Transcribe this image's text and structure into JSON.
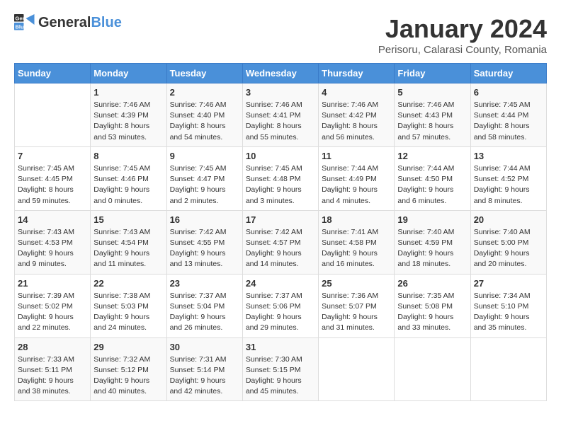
{
  "logo": {
    "general": "General",
    "blue": "Blue"
  },
  "title": "January 2024",
  "subtitle": "Perisoru, Calarasi County, Romania",
  "days_header": [
    "Sunday",
    "Monday",
    "Tuesday",
    "Wednesday",
    "Thursday",
    "Friday",
    "Saturday"
  ],
  "weeks": [
    [
      {
        "day": "",
        "info": ""
      },
      {
        "day": "1",
        "info": "Sunrise: 7:46 AM\nSunset: 4:39 PM\nDaylight: 8 hours\nand 53 minutes."
      },
      {
        "day": "2",
        "info": "Sunrise: 7:46 AM\nSunset: 4:40 PM\nDaylight: 8 hours\nand 54 minutes."
      },
      {
        "day": "3",
        "info": "Sunrise: 7:46 AM\nSunset: 4:41 PM\nDaylight: 8 hours\nand 55 minutes."
      },
      {
        "day": "4",
        "info": "Sunrise: 7:46 AM\nSunset: 4:42 PM\nDaylight: 8 hours\nand 56 minutes."
      },
      {
        "day": "5",
        "info": "Sunrise: 7:46 AM\nSunset: 4:43 PM\nDaylight: 8 hours\nand 57 minutes."
      },
      {
        "day": "6",
        "info": "Sunrise: 7:45 AM\nSunset: 4:44 PM\nDaylight: 8 hours\nand 58 minutes."
      }
    ],
    [
      {
        "day": "7",
        "info": "Sunrise: 7:45 AM\nSunset: 4:45 PM\nDaylight: 8 hours\nand 59 minutes."
      },
      {
        "day": "8",
        "info": "Sunrise: 7:45 AM\nSunset: 4:46 PM\nDaylight: 9 hours\nand 0 minutes."
      },
      {
        "day": "9",
        "info": "Sunrise: 7:45 AM\nSunset: 4:47 PM\nDaylight: 9 hours\nand 2 minutes."
      },
      {
        "day": "10",
        "info": "Sunrise: 7:45 AM\nSunset: 4:48 PM\nDaylight: 9 hours\nand 3 minutes."
      },
      {
        "day": "11",
        "info": "Sunrise: 7:44 AM\nSunset: 4:49 PM\nDaylight: 9 hours\nand 4 minutes."
      },
      {
        "day": "12",
        "info": "Sunrise: 7:44 AM\nSunset: 4:50 PM\nDaylight: 9 hours\nand 6 minutes."
      },
      {
        "day": "13",
        "info": "Sunrise: 7:44 AM\nSunset: 4:52 PM\nDaylight: 9 hours\nand 8 minutes."
      }
    ],
    [
      {
        "day": "14",
        "info": "Sunrise: 7:43 AM\nSunset: 4:53 PM\nDaylight: 9 hours\nand 9 minutes."
      },
      {
        "day": "15",
        "info": "Sunrise: 7:43 AM\nSunset: 4:54 PM\nDaylight: 9 hours\nand 11 minutes."
      },
      {
        "day": "16",
        "info": "Sunrise: 7:42 AM\nSunset: 4:55 PM\nDaylight: 9 hours\nand 13 minutes."
      },
      {
        "day": "17",
        "info": "Sunrise: 7:42 AM\nSunset: 4:57 PM\nDaylight: 9 hours\nand 14 minutes."
      },
      {
        "day": "18",
        "info": "Sunrise: 7:41 AM\nSunset: 4:58 PM\nDaylight: 9 hours\nand 16 minutes."
      },
      {
        "day": "19",
        "info": "Sunrise: 7:40 AM\nSunset: 4:59 PM\nDaylight: 9 hours\nand 18 minutes."
      },
      {
        "day": "20",
        "info": "Sunrise: 7:40 AM\nSunset: 5:00 PM\nDaylight: 9 hours\nand 20 minutes."
      }
    ],
    [
      {
        "day": "21",
        "info": "Sunrise: 7:39 AM\nSunset: 5:02 PM\nDaylight: 9 hours\nand 22 minutes."
      },
      {
        "day": "22",
        "info": "Sunrise: 7:38 AM\nSunset: 5:03 PM\nDaylight: 9 hours\nand 24 minutes."
      },
      {
        "day": "23",
        "info": "Sunrise: 7:37 AM\nSunset: 5:04 PM\nDaylight: 9 hours\nand 26 minutes."
      },
      {
        "day": "24",
        "info": "Sunrise: 7:37 AM\nSunset: 5:06 PM\nDaylight: 9 hours\nand 29 minutes."
      },
      {
        "day": "25",
        "info": "Sunrise: 7:36 AM\nSunset: 5:07 PM\nDaylight: 9 hours\nand 31 minutes."
      },
      {
        "day": "26",
        "info": "Sunrise: 7:35 AM\nSunset: 5:08 PM\nDaylight: 9 hours\nand 33 minutes."
      },
      {
        "day": "27",
        "info": "Sunrise: 7:34 AM\nSunset: 5:10 PM\nDaylight: 9 hours\nand 35 minutes."
      }
    ],
    [
      {
        "day": "28",
        "info": "Sunrise: 7:33 AM\nSunset: 5:11 PM\nDaylight: 9 hours\nand 38 minutes."
      },
      {
        "day": "29",
        "info": "Sunrise: 7:32 AM\nSunset: 5:12 PM\nDaylight: 9 hours\nand 40 minutes."
      },
      {
        "day": "30",
        "info": "Sunrise: 7:31 AM\nSunset: 5:14 PM\nDaylight: 9 hours\nand 42 minutes."
      },
      {
        "day": "31",
        "info": "Sunrise: 7:30 AM\nSunset: 5:15 PM\nDaylight: 9 hours\nand 45 minutes."
      },
      {
        "day": "",
        "info": ""
      },
      {
        "day": "",
        "info": ""
      },
      {
        "day": "",
        "info": ""
      }
    ]
  ]
}
